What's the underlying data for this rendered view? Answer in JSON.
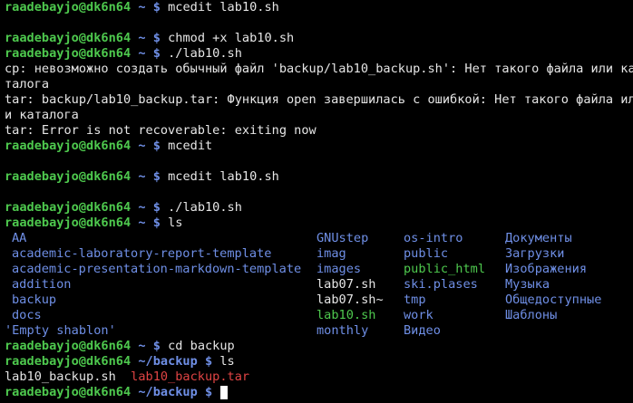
{
  "colors": {
    "background": "#000000",
    "text": "#e6e6e6",
    "prompt_user": "#4ec94e",
    "prompt_path": "#6f8fe6",
    "directory": "#6f8fe6",
    "executable": "#4ec94e",
    "archive": "#e04444"
  },
  "prompt": {
    "user": "raadebayjo@dk6n64",
    "home": "~",
    "backup": "~/backup",
    "symbol": "$"
  },
  "lines": {
    "l1": {
      "cmd": "mcedit lab10.sh"
    },
    "l2": {
      "cmd": "chmod +x lab10.sh"
    },
    "l3": {
      "cmd": "./lab10.sh"
    },
    "err1": "cp: невозможно создать обычный файл 'backup/lab10_backup.sh': Нет такого файла или ка",
    "err1b": "талога",
    "err2": "tar: backup/lab10_backup.tar: Функция open завершилась с ошибкой: Нет такого файла ил",
    "err2b": "и каталога",
    "err3": "tar: Error is not recoverable: exiting now",
    "l4": {
      "cmd": "mcedit"
    },
    "l5": {
      "cmd": "mcedit lab10.sh"
    },
    "l6": {
      "cmd": "./lab10.sh"
    },
    "l7": {
      "cmd": "ls"
    },
    "l8": {
      "cmd": "cd backup"
    },
    "l9": {
      "cmd": "ls"
    }
  },
  "ls_home": {
    "col0": [
      "AA",
      "academic-laboratory-report-template",
      "academic-presentation-markdown-template",
      "addition",
      "backup",
      "docs",
      "'Empty shablon'"
    ],
    "col1": [
      "GNUstep",
      "imag",
      "images",
      "lab07.sh",
      "lab07.sh~",
      "lab10.sh",
      "monthly"
    ],
    "col2": [
      "os-intro",
      "public",
      "public_html",
      "ski.plases",
      "tmp",
      "work",
      "Видео"
    ],
    "col3": [
      "Документы",
      "Загрузки",
      "Изображения",
      "Музыка",
      "Общедоступные",
      "Шаблоны"
    ]
  },
  "ls_backup": [
    "lab10_backup.sh",
    "lab10_backup.tar"
  ]
}
